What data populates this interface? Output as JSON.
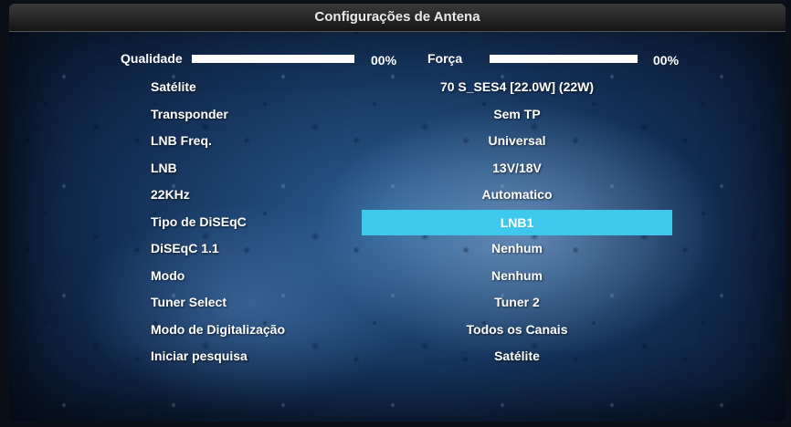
{
  "title": "Configurações de Antena",
  "meters": {
    "quality": {
      "label": "Qualidade",
      "percent_text": "00%",
      "level": 0
    },
    "strength": {
      "label": "Força",
      "percent_text": "00%",
      "level": 0
    }
  },
  "settings": [
    {
      "label": "Satélite",
      "value": "70 S_SES4 [22.0W] (22W)"
    },
    {
      "label": "Transponder",
      "value": "Sem TP"
    },
    {
      "label": "LNB Freq.",
      "value": "Universal"
    },
    {
      "label": "LNB",
      "value": "13V/18V"
    },
    {
      "label": "22KHz",
      "value": "Automatico"
    },
    {
      "label": "Tipo de DiSEqC",
      "value": "LNB1"
    },
    {
      "label": "DiSEqC 1.1",
      "value": "Nenhum"
    },
    {
      "label": "Modo",
      "value": "Nenhum"
    },
    {
      "label": "Tuner Select",
      "value": "Tuner 2"
    },
    {
      "label": "Modo de Digitalização",
      "value": "Todos os Canais"
    },
    {
      "label": "Iniciar pesquisa",
      "value": "Satélite"
    }
  ],
  "selected_index": 5,
  "colors": {
    "highlight": "#3ec8ee",
    "title_bar": "#2a2a2a",
    "background": "#1f4a7a"
  }
}
